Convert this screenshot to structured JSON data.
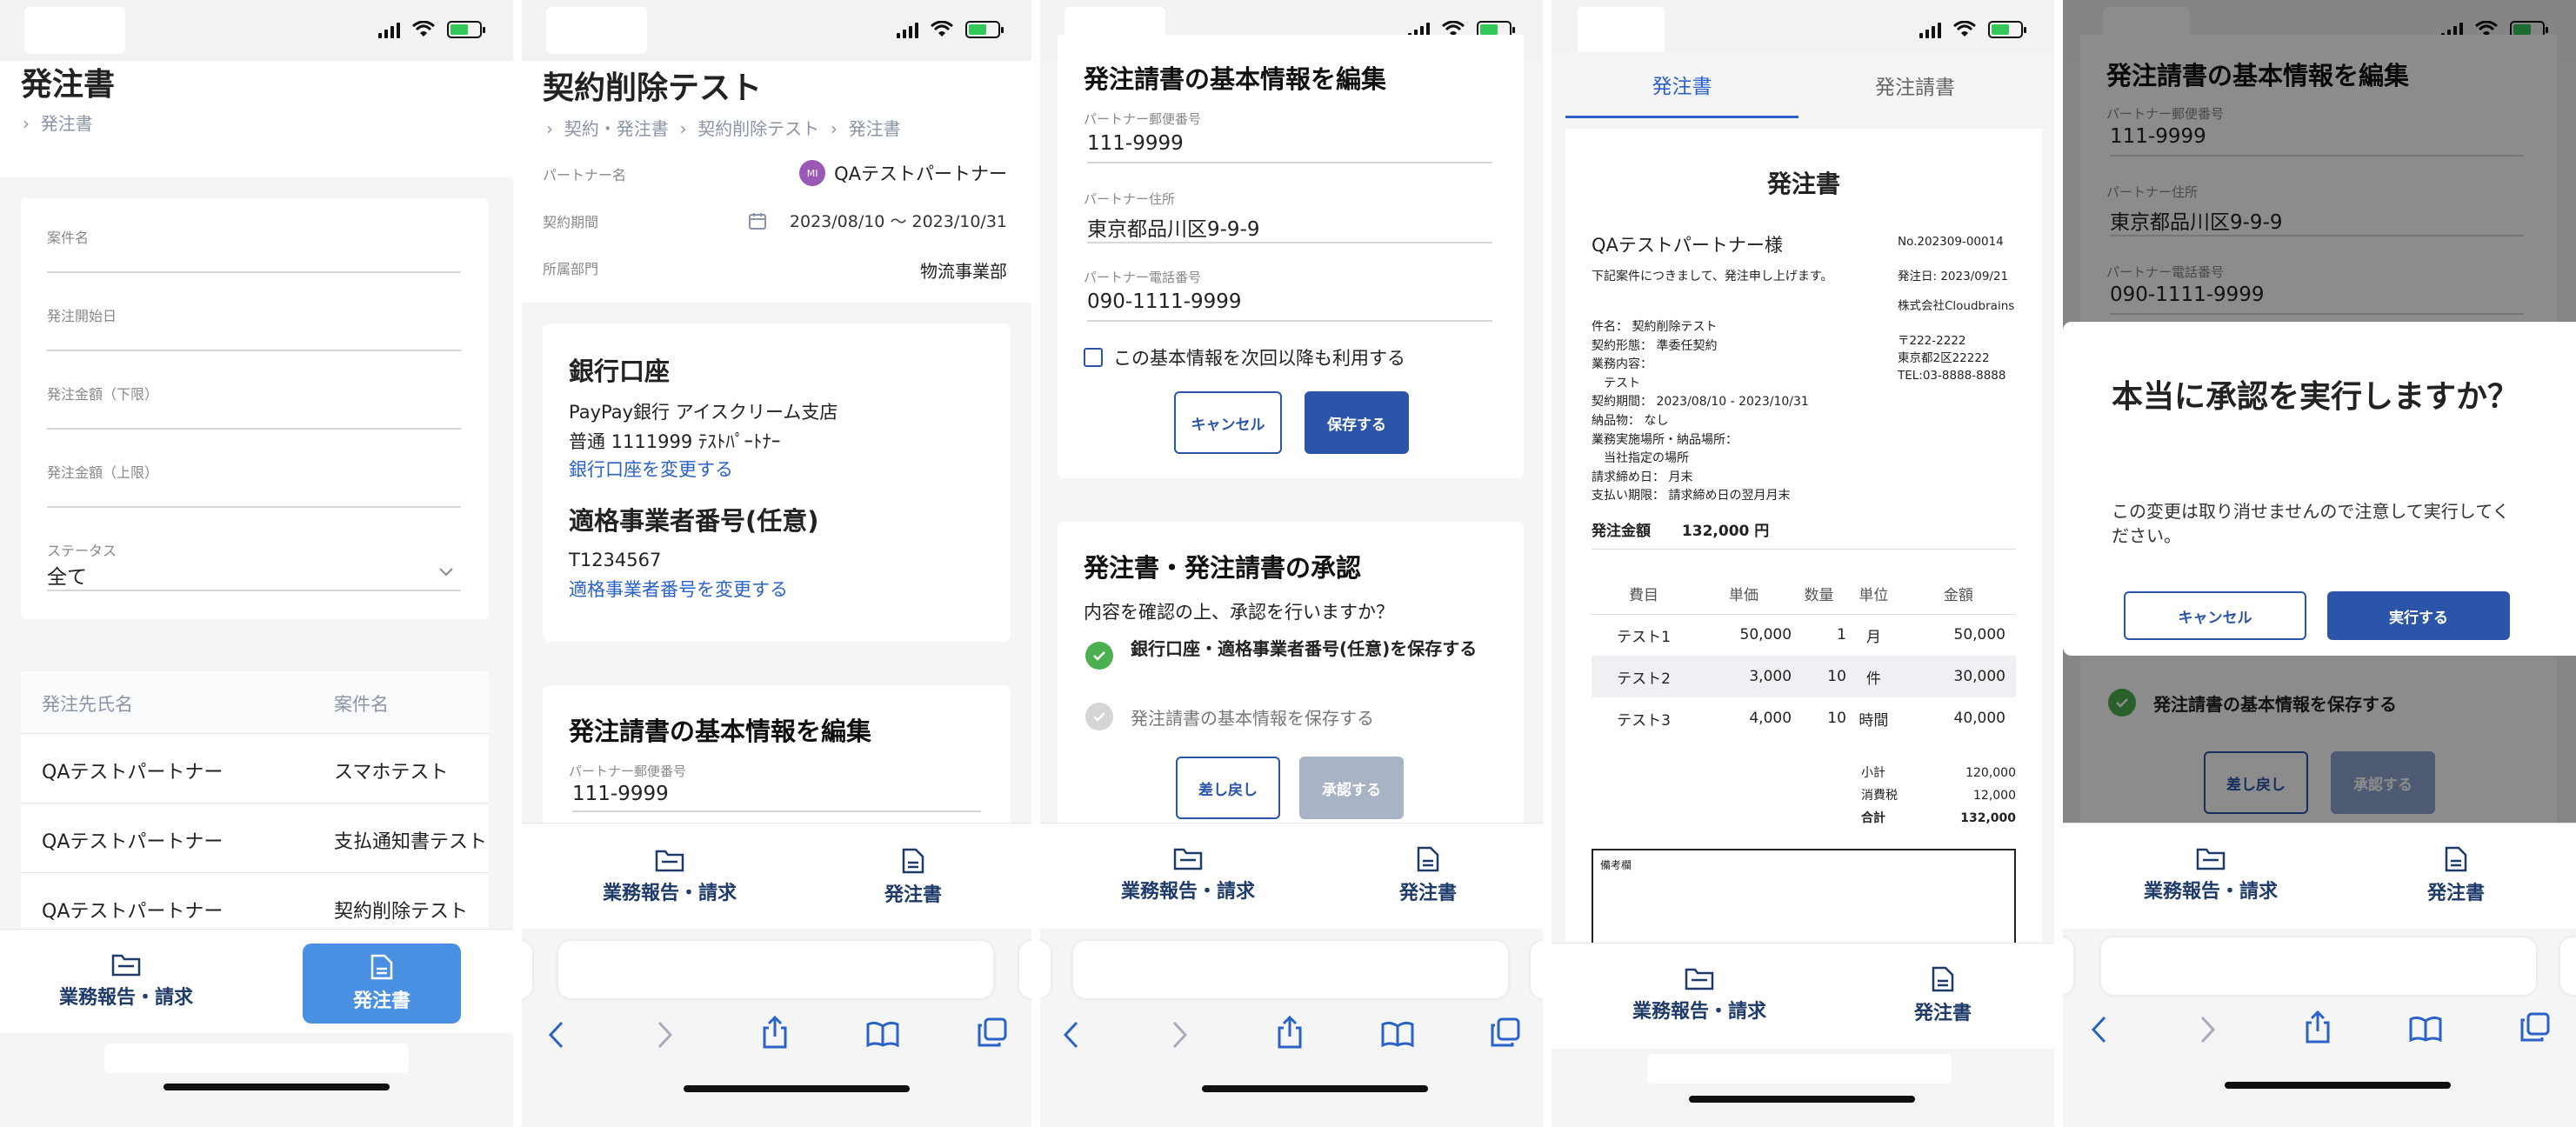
{
  "common": {
    "tab_reports": "業務報告・請求",
    "tab_po": "発注書"
  },
  "screen1": {
    "title": "発注書",
    "breadcrumb": "発注書",
    "filters": {
      "project": "案件名",
      "start": "発注開始日",
      "min_amount": "発注金額（下限）",
      "max_amount": "発注金額（上限）",
      "status_label": "ステータス",
      "status_value": "全て"
    },
    "table": {
      "headers": [
        "発注先氏名",
        "案件名"
      ],
      "rows": [
        [
          "QAテストパートナー",
          "スマホテスト"
        ],
        [
          "QAテストパートナー",
          "支払通知書テスト"
        ],
        [
          "QAテストパートナー",
          "契約削除テスト"
        ]
      ]
    }
  },
  "screen2": {
    "title": "契約削除テスト",
    "breadcrumb": [
      "契約・発注書",
      "契約削除テスト",
      "発注書"
    ],
    "partner_label": "パートナー名",
    "partner_avatar": "MI",
    "partner_value": "QAテストパートナー",
    "period_label": "契約期間",
    "period_value": "2023/08/10 〜 2023/10/31",
    "dept_label": "所属部門",
    "dept_value": "物流事業部",
    "bank_title": "銀行口座",
    "bank_line1": "PayPay銀行 アイスクリーム支店",
    "bank_line2": "普通 1111999 ﾃｽﾄﾊﾟｰﾄﾅｰ",
    "bank_change": "銀行口座を変更する",
    "invoice_title": "適格事業者番号(任意)",
    "invoice_value": "T1234567",
    "invoice_change": "適格事業者番号を変更する",
    "edit_title": "発注請書の基本情報を編集",
    "postal_label": "パートナー郵便番号",
    "postal_value": "111-9999"
  },
  "screen3": {
    "edit_title": "発注請書の基本情報を編集",
    "postal_label": "パートナー郵便番号",
    "postal_value": "111-9999",
    "address_label": "パートナー住所",
    "address_value": "東京都品川区9-9-9",
    "phone_label": "パートナー電話番号",
    "phone_value": "090-1111-9999",
    "reuse_checkbox": "この基本情報を次回以降も利用する",
    "cancel": "キャンセル",
    "save": "保存する",
    "approve_title": "発注書・発注請書の承認",
    "approve_question": "内容を確認の上、承認を行いますか？",
    "step1": "銀行口座・適格事業者番号(任意)を保存する",
    "step2": "発注請書の基本情報を保存する",
    "reject": "差し戻し",
    "approve": "承認する"
  },
  "screen4": {
    "tabs": [
      "発注書",
      "発注請書"
    ],
    "doc_title": "発注書",
    "recipient": "QAテストパートナー様",
    "intro": "下記案件につきまして、発注申し上げます。",
    "details": [
      "件名： 契約削除テスト",
      "契約形態： 準委任契約",
      "業務内容：",
      "　テスト",
      "契約期間： 2023/08/10 - 2023/10/31",
      "納品物： なし",
      "業務実施場所・納品場所：",
      "　当社指定の場所",
      "請求締め日： 月末",
      "支払い期限： 請求締め日の翌月月末"
    ],
    "po_no": "No.202309-00014",
    "issue_date": "発注日: 2023/09/21",
    "company": "株式会社Cloudbrains",
    "company_zip": "〒222-2222",
    "company_addr": "東京都2区22222",
    "company_tel": "TEL:03-8888-8888",
    "amount_label": "発注金額",
    "amount_value": "132,000 円",
    "item_headers": [
      "費目",
      "単価",
      "数量",
      "単位",
      "金額"
    ],
    "items": [
      [
        "テスト1",
        "50,000",
        "1",
        "月",
        "50,000"
      ],
      [
        "テスト2",
        "3,000",
        "10",
        "件",
        "30,000"
      ],
      [
        "テスト3",
        "4,000",
        "10",
        "時間",
        "40,000"
      ]
    ],
    "subtotal_label": "小計",
    "subtotal": "120,000",
    "tax_label": "消費税",
    "tax": "12,000",
    "total_label": "合計",
    "total": "132,000",
    "remarks": "備考欄"
  },
  "screen5": {
    "edit_title": "発注請書の基本情報を編集",
    "postal_label": "パートナー郵便番号",
    "postal_value": "111-9999",
    "address_label": "パートナー住所",
    "address_value": "東京都品川区9-9-9",
    "phone_label": "パートナー電話番号",
    "phone_value": "090-1111-9999",
    "dialog_title": "本当に承認を実行しますか？",
    "dialog_body": "この変更は取り消せませんので注意して実行してください。",
    "cancel": "キャンセル",
    "execute": "実行する",
    "step2": "発注請書の基本情報を保存する",
    "reject": "差し戻し",
    "approve": "承認する"
  }
}
